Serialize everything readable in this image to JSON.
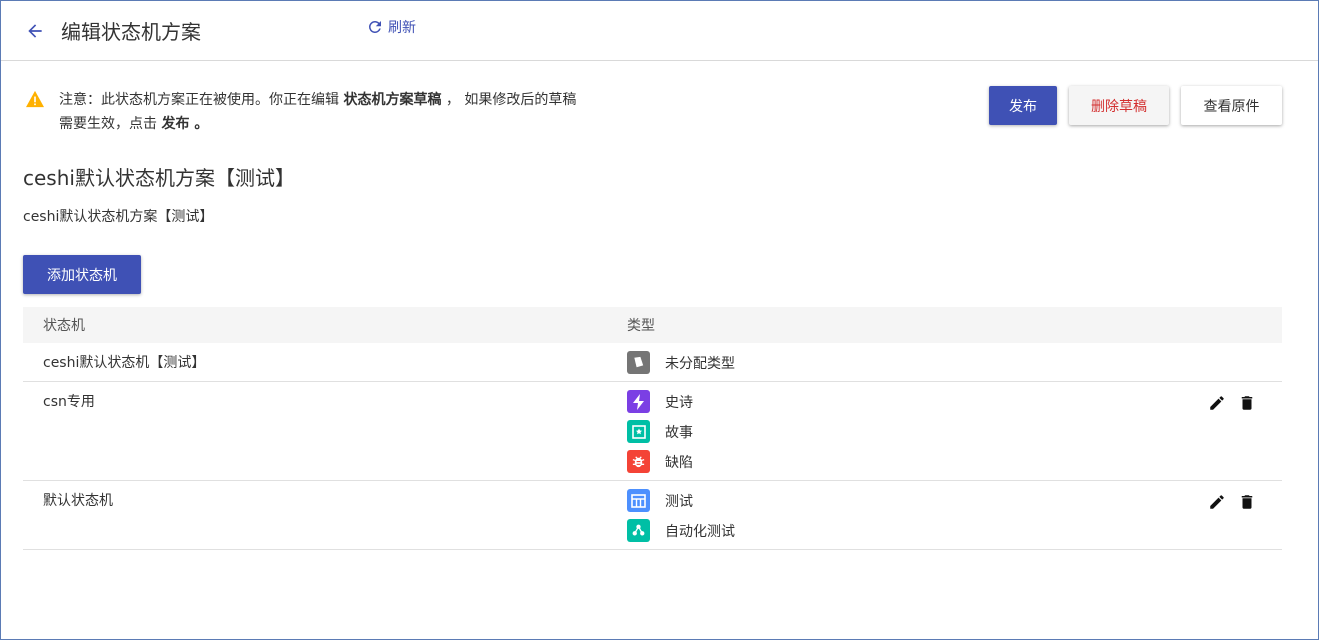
{
  "header": {
    "title": "编辑状态机方案",
    "refresh_label": "刷新"
  },
  "notice": {
    "part1": "注意：此状态机方案正在被使用。你正在编辑 ",
    "bold1": "状态机方案草稿",
    "part2": " ， 如果修改后的草稿",
    "part3": "需要生效，点击 ",
    "bold2": "发布",
    "part4": " 。"
  },
  "actions": {
    "publish": "发布",
    "delete_draft": "删除草稿",
    "view_original": "查看原件"
  },
  "scheme": {
    "title": "ceshi默认状态机方案【测试】",
    "description": "ceshi默认状态机方案【测试】"
  },
  "add_button": "添加状态机",
  "table": {
    "headers": {
      "name": "状态机",
      "type": "类型"
    },
    "rows": [
      {
        "name": "ceshi默认状态机【测试】",
        "types": [
          {
            "label": "未分配类型",
            "icon": "unassigned-icon",
            "color": "#757575"
          }
        ]
      },
      {
        "name": "csn专用",
        "types": [
          {
            "label": "史诗",
            "icon": "lightning-icon",
            "color": "#7b3fe4"
          },
          {
            "label": "故事",
            "icon": "bookmark-icon",
            "color": "#00bfa5"
          },
          {
            "label": "缺陷",
            "icon": "bug-icon",
            "color": "#f44336"
          }
        ]
      },
      {
        "name": "默认状态机",
        "types": [
          {
            "label": "测试",
            "icon": "table-icon",
            "color": "#4d90fe"
          },
          {
            "label": "自动化测试",
            "icon": "automation-icon",
            "color": "#00bfa5"
          }
        ]
      }
    ]
  },
  "colors": {
    "primary": "#3f51b5",
    "danger_text": "#d32f2f",
    "warning": "#ffb100"
  }
}
